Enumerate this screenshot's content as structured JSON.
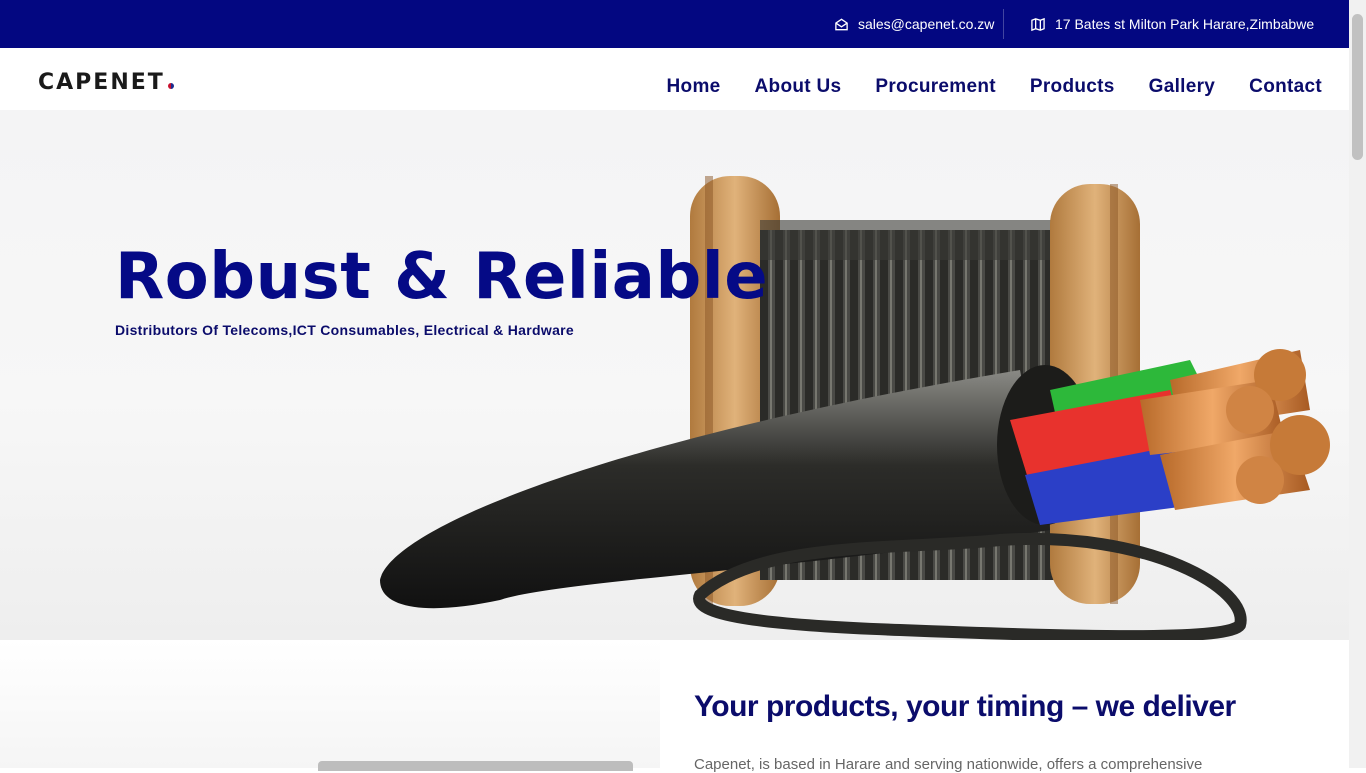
{
  "topbar": {
    "email": "sales@capenet.co.zw",
    "address": "17 Bates st Milton Park Harare,Zimbabwe",
    "email_icon": "envelope-open-icon",
    "address_icon": "map-icon"
  },
  "brand": {
    "name": "CAPENET"
  },
  "nav": {
    "items": [
      {
        "label": "Home"
      },
      {
        "label": "About Us"
      },
      {
        "label": "Procurement"
      },
      {
        "label": "Products"
      },
      {
        "label": "Gallery"
      },
      {
        "label": "Contact"
      }
    ]
  },
  "hero": {
    "title": "Robust & Reliable",
    "subtitle": "Distributors Of Telecoms,ICT Consumables, Electrical & Hardware"
  },
  "intro": {
    "heading": "Your products, your timing – we deliver",
    "body": "Capenet, is based in Harare and serving nationwide, offers a comprehensive"
  },
  "colors": {
    "topbar": "#030781",
    "heading": "#050a86",
    "nav": "#0b0c6b"
  }
}
